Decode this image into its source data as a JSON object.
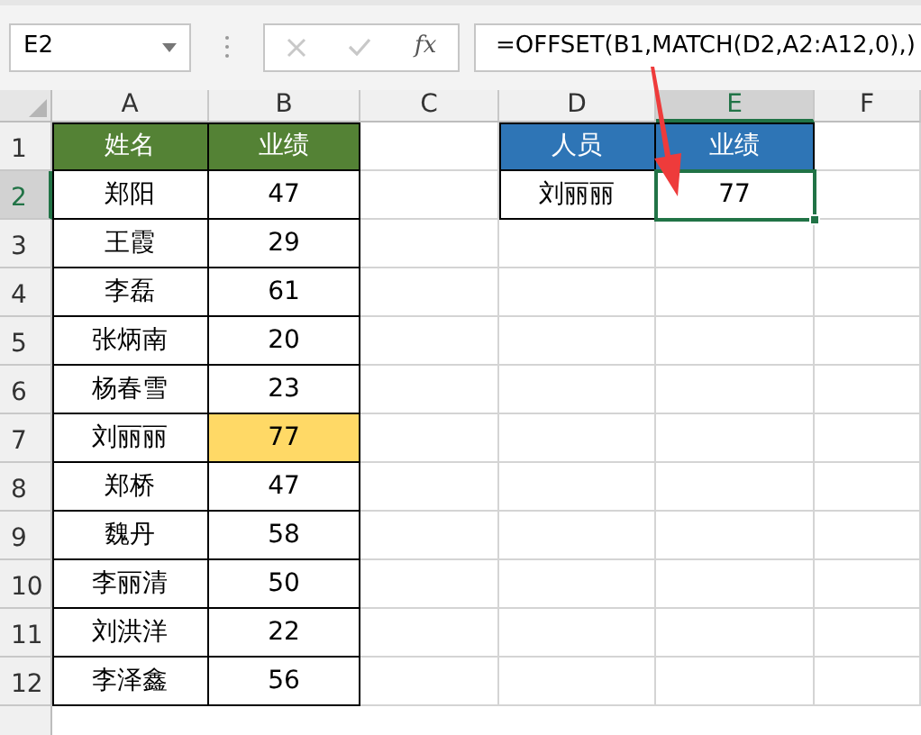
{
  "name_box": {
    "value": "E2"
  },
  "formula_bar": {
    "fx_label": "fx",
    "value": "=OFFSET(B1,MATCH(D2,A2:A12,0),)"
  },
  "grid": {
    "columns": [
      {
        "label": "A",
        "selected": false
      },
      {
        "label": "B",
        "selected": false
      },
      {
        "label": "C",
        "selected": false
      },
      {
        "label": "D",
        "selected": false
      },
      {
        "label": "E",
        "selected": true
      },
      {
        "label": "F",
        "selected": false
      }
    ],
    "rows": [
      {
        "label": "1",
        "selected": false,
        "cells": [
          {
            "kind": "header",
            "text": "姓名",
            "color": "#548235"
          },
          {
            "kind": "header",
            "text": "业绩",
            "color": "#548235"
          },
          {
            "kind": "empty"
          },
          {
            "kind": "header",
            "text": "人员",
            "color": "#2e75b6"
          },
          {
            "kind": "header",
            "text": "业绩",
            "color": "#2e75b6"
          },
          {
            "kind": "empty"
          }
        ]
      },
      {
        "label": "2",
        "selected": true,
        "cells": [
          {
            "kind": "data",
            "text": "郑阳"
          },
          {
            "kind": "data",
            "text": "47"
          },
          {
            "kind": "empty"
          },
          {
            "kind": "data",
            "text": "刘丽丽"
          },
          {
            "kind": "data",
            "text": "77",
            "selected": true
          },
          {
            "kind": "empty"
          }
        ]
      },
      {
        "label": "3",
        "selected": false,
        "cells": [
          {
            "kind": "data",
            "text": "王霞"
          },
          {
            "kind": "data",
            "text": "29"
          },
          {
            "kind": "empty"
          },
          {
            "kind": "empty"
          },
          {
            "kind": "empty"
          },
          {
            "kind": "empty"
          }
        ]
      },
      {
        "label": "4",
        "selected": false,
        "cells": [
          {
            "kind": "data",
            "text": "李磊"
          },
          {
            "kind": "data",
            "text": "61"
          },
          {
            "kind": "empty"
          },
          {
            "kind": "empty"
          },
          {
            "kind": "empty"
          },
          {
            "kind": "empty"
          }
        ]
      },
      {
        "label": "5",
        "selected": false,
        "cells": [
          {
            "kind": "data",
            "text": "张炳南"
          },
          {
            "kind": "data",
            "text": "20"
          },
          {
            "kind": "empty"
          },
          {
            "kind": "empty"
          },
          {
            "kind": "empty"
          },
          {
            "kind": "empty"
          }
        ]
      },
      {
        "label": "6",
        "selected": false,
        "cells": [
          {
            "kind": "data",
            "text": "杨春雪"
          },
          {
            "kind": "data",
            "text": "23"
          },
          {
            "kind": "empty"
          },
          {
            "kind": "empty"
          },
          {
            "kind": "empty"
          },
          {
            "kind": "empty"
          }
        ]
      },
      {
        "label": "7",
        "selected": false,
        "cells": [
          {
            "kind": "data",
            "text": "刘丽丽"
          },
          {
            "kind": "data",
            "text": "77",
            "color": "#ffd966"
          },
          {
            "kind": "empty"
          },
          {
            "kind": "empty"
          },
          {
            "kind": "empty"
          },
          {
            "kind": "empty"
          }
        ]
      },
      {
        "label": "8",
        "selected": false,
        "cells": [
          {
            "kind": "data",
            "text": "郑桥"
          },
          {
            "kind": "data",
            "text": "47"
          },
          {
            "kind": "empty"
          },
          {
            "kind": "empty"
          },
          {
            "kind": "empty"
          },
          {
            "kind": "empty"
          }
        ]
      },
      {
        "label": "9",
        "selected": false,
        "cells": [
          {
            "kind": "data",
            "text": "魏丹"
          },
          {
            "kind": "data",
            "text": "58"
          },
          {
            "kind": "empty"
          },
          {
            "kind": "empty"
          },
          {
            "kind": "empty"
          },
          {
            "kind": "empty"
          }
        ]
      },
      {
        "label": "10",
        "selected": false,
        "cells": [
          {
            "kind": "data",
            "text": "李丽清"
          },
          {
            "kind": "data",
            "text": "50"
          },
          {
            "kind": "empty"
          },
          {
            "kind": "empty"
          },
          {
            "kind": "empty"
          },
          {
            "kind": "empty"
          }
        ]
      },
      {
        "label": "11",
        "selected": false,
        "cells": [
          {
            "kind": "data",
            "text": "刘洪洋"
          },
          {
            "kind": "data",
            "text": "22"
          },
          {
            "kind": "empty"
          },
          {
            "kind": "empty"
          },
          {
            "kind": "empty"
          },
          {
            "kind": "empty"
          }
        ]
      },
      {
        "label": "12",
        "selected": false,
        "cells": [
          {
            "kind": "data",
            "text": "李泽鑫"
          },
          {
            "kind": "data",
            "text": "56"
          },
          {
            "kind": "empty"
          },
          {
            "kind": "empty"
          },
          {
            "kind": "empty"
          },
          {
            "kind": "empty"
          }
        ]
      }
    ]
  }
}
